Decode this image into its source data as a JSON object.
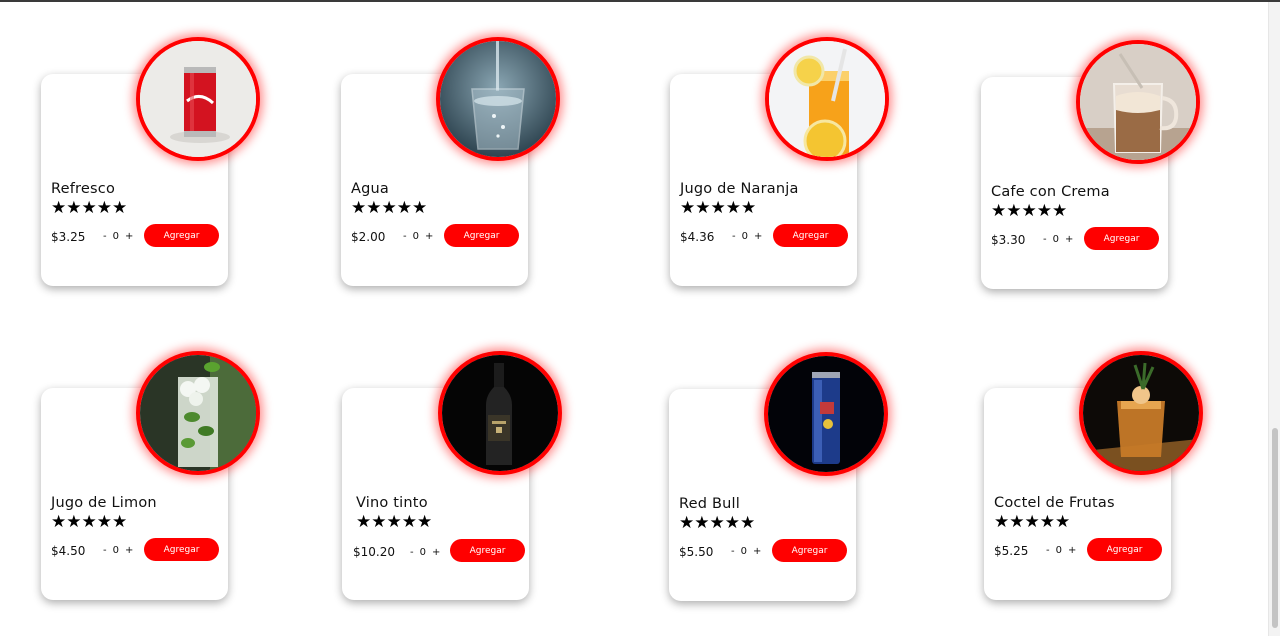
{
  "colors": {
    "accent": "#ff0000",
    "background": "#ffffff"
  },
  "products": [
    {
      "name": "Refresco",
      "stars": "★★★★★",
      "rating": 5,
      "price": "$3.25",
      "minus": "-",
      "quantity": "0",
      "plus": "+",
      "button": "Agregar",
      "image": "soda-can-image"
    },
    {
      "name": "Agua",
      "stars": "★★★★★",
      "rating": 5,
      "price": "$2.00",
      "minus": "-",
      "quantity": "0",
      "plus": "+",
      "button": "Agregar",
      "image": "water-glass-image"
    },
    {
      "name": "Jugo de Naranja",
      "stars": "★★★★★",
      "rating": 5,
      "price": "$4.36",
      "minus": "-",
      "quantity": "0",
      "plus": "+",
      "button": "Agregar",
      "image": "orange-juice-image"
    },
    {
      "name": "Cafe con Crema",
      "stars": "★★★★★",
      "rating": 5,
      "price": "$3.30",
      "minus": "-",
      "quantity": "0",
      "plus": "+",
      "button": "Agregar",
      "image": "iced-coffee-image"
    },
    {
      "name": "Jugo de Limon",
      "stars": "★★★★★",
      "rating": 5,
      "price": "$4.50",
      "minus": "-",
      "quantity": "0",
      "plus": "+",
      "button": "Agregar",
      "image": "lemon-drink-image"
    },
    {
      "name": "Vino tinto",
      "stars": "★★★★★",
      "rating": 5,
      "price": "$10.20",
      "minus": "-",
      "quantity": "0",
      "plus": "+",
      "button": "Agregar",
      "image": "wine-bottle-image"
    },
    {
      "name": "Red Bull",
      "stars": "★★★★★",
      "rating": 5,
      "price": "$5.50",
      "minus": "-",
      "quantity": "0",
      "plus": "+",
      "button": "Agregar",
      "image": "energy-drink-image"
    },
    {
      "name": "Coctel de Frutas",
      "stars": "★★★★★",
      "rating": 5,
      "price": "$5.25",
      "minus": "-",
      "quantity": "0",
      "plus": "+",
      "button": "Agregar",
      "image": "cocktail-image"
    }
  ]
}
